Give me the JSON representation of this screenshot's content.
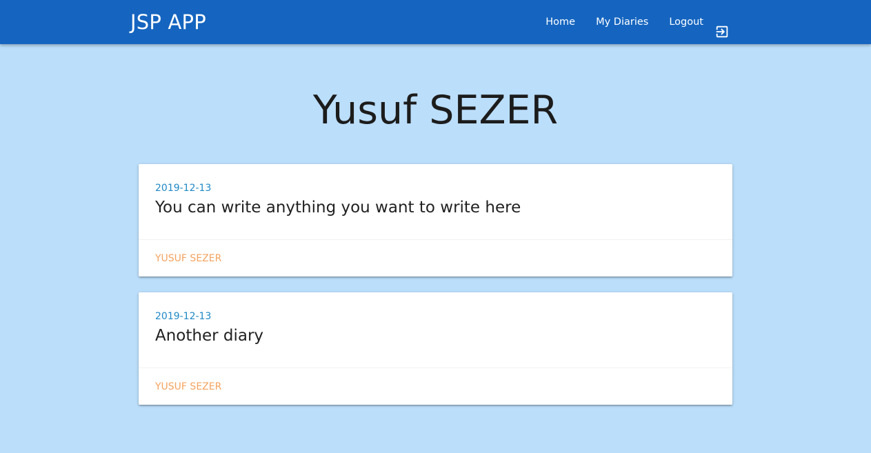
{
  "navbar": {
    "brand": "JSP APP",
    "links": [
      {
        "label": "Home"
      },
      {
        "label": "My Diaries"
      },
      {
        "label": "Logout",
        "icon": "logout-icon"
      }
    ]
  },
  "page": {
    "title": "Yusuf SEZER"
  },
  "diaries": [
    {
      "date": "2019-12-13",
      "title": "You can write anything you want to write here",
      "author": "YUSUF SEZER"
    },
    {
      "date": "2019-12-13",
      "title": "Another diary",
      "author": "YUSUF SEZER"
    }
  ],
  "colors": {
    "navbar": "#1565c0",
    "background": "#bbdefb",
    "date": "#1e88c7",
    "author": "#f5a25d"
  }
}
